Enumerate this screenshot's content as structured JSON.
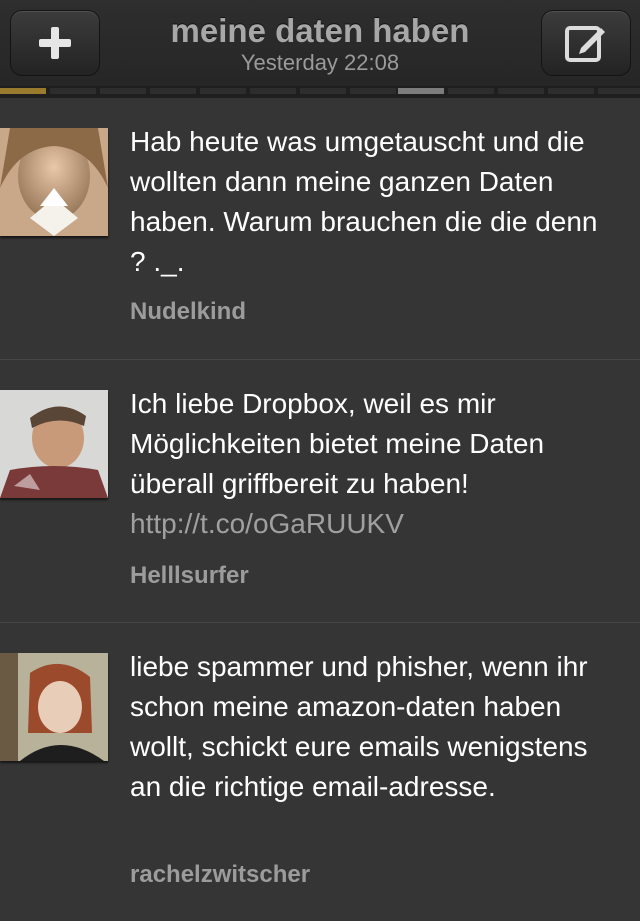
{
  "header": {
    "title": "meine daten haben",
    "subtitle": "Yesterday 22:08",
    "add_icon": "plus-icon",
    "compose_icon": "compose-icon"
  },
  "pager": {
    "active_index": 8,
    "count": 13
  },
  "tweets": [
    {
      "text": "Hab heute was umgetauscht und die wollten dann meine ganzen Daten haben. Warum brauchen die die denn ? ._.",
      "link": "",
      "user": "Nudelkind"
    },
    {
      "text": "Ich liebe Dropbox, weil es mir Möglichkeiten bietet meine Daten überall griffbereit zu haben!",
      "link": "http://t.co/oGaRUUKV",
      "user": "Helllsurfer"
    },
    {
      "text": "liebe spammer und phisher, wenn ihr schon meine amazon-daten haben wollt, schickt eure emails wenigstens an die richtige email-adresse.",
      "link": "",
      "user": "rachelzwitscher"
    }
  ]
}
